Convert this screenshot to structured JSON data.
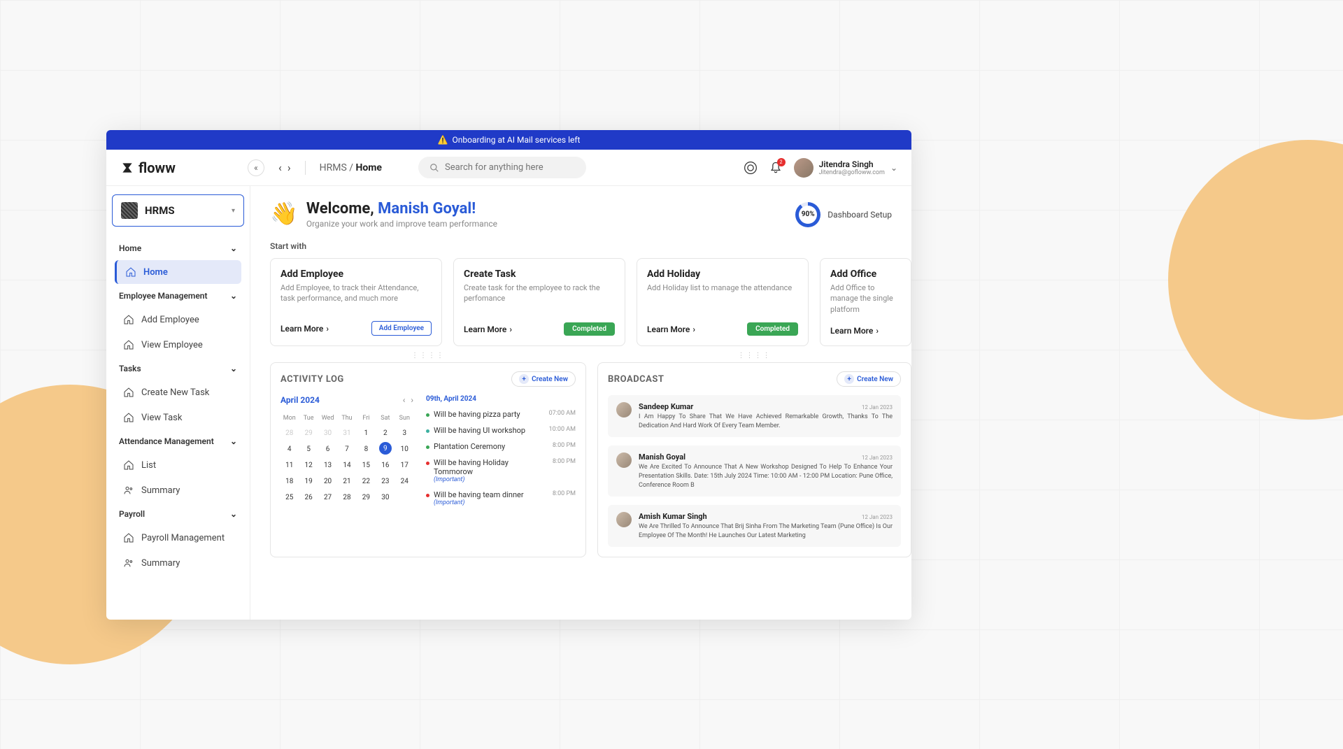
{
  "alert": {
    "text": "Onboarding at AI Mail services left"
  },
  "brand": "floww",
  "breadcrumb": {
    "parent": "HRMS",
    "current": "Home"
  },
  "search": {
    "placeholder": "Search for anything here"
  },
  "user": {
    "name": "Jitendra Singh",
    "email": "Jitendra@gofloww.com"
  },
  "module": {
    "name": "HRMS"
  },
  "nav": {
    "groups": [
      {
        "label": "Home",
        "items": [
          {
            "label": "Home",
            "active": true
          }
        ]
      },
      {
        "label": "Employee Management",
        "items": [
          {
            "label": "Add Employee"
          },
          {
            "label": "View Employee"
          }
        ]
      },
      {
        "label": "Tasks",
        "items": [
          {
            "label": "Create New Task"
          },
          {
            "label": "View Task"
          }
        ]
      },
      {
        "label": "Attendance Management",
        "items": [
          {
            "label": "List"
          },
          {
            "label": "Summary"
          }
        ]
      },
      {
        "label": "Payroll",
        "items": [
          {
            "label": "Payroll Management"
          },
          {
            "label": "Summary"
          }
        ]
      }
    ]
  },
  "welcome": {
    "greeting": "Welcome, ",
    "name": "Manish Goyal!",
    "subtitle": "Organize your work and improve team performance"
  },
  "setup": {
    "percent": "90%",
    "label": "Dashboard Setup"
  },
  "start_with_label": "Start with",
  "start_cards": [
    {
      "title": "Add Employee",
      "desc": "Add Employee, to track their Attendance, task performance, and much more",
      "learn": "Learn More",
      "action_label": "Add Employee",
      "action_type": "outline"
    },
    {
      "title": "Create Task",
      "desc": "Create task for the employee to rack the perfomance",
      "learn": "Learn More",
      "action_label": "Completed",
      "action_type": "green"
    },
    {
      "title": "Add Holiday",
      "desc": "Add Holiday list to manage the attendance",
      "learn": "Learn More",
      "action_label": "Completed",
      "action_type": "green"
    },
    {
      "title": "Add Office",
      "desc": "Add Office to manage the single platform",
      "learn": "Learn More",
      "action_label": "",
      "action_type": "none"
    }
  ],
  "activity": {
    "title": "ACTIVITY LOG",
    "create_label": "Create New",
    "calendar": {
      "month": "April 2024",
      "dow": [
        "Mon",
        "Tue",
        "Wed",
        "Thu",
        "Fri",
        "Sat",
        "Sun"
      ],
      "leading": [
        "28",
        "29",
        "30",
        "31"
      ],
      "days_count": 30,
      "selected": 9
    },
    "list_date": "09th, April 2024",
    "items": [
      {
        "dot": "green",
        "text": "Will be having pizza party",
        "time": "07:00 AM",
        "important": false
      },
      {
        "dot": "teal",
        "text": "Will be having UI workshop",
        "time": "10:00 AM",
        "important": false
      },
      {
        "dot": "green",
        "text": "Plantation Ceremony",
        "time": "8:00 PM",
        "important": false
      },
      {
        "dot": "red",
        "text": "Will be having Holiday Tommorow",
        "time": "8:00 PM",
        "important": true
      },
      {
        "dot": "red",
        "text": "Will be having team dinner",
        "time": "8:00 PM",
        "important": true
      }
    ],
    "important_label": "(Important)"
  },
  "broadcast": {
    "title": "BROADCAST",
    "create_label": "Create New",
    "items": [
      {
        "name": "Sandeep Kumar",
        "date": "12 Jan 2023",
        "text": "I Am Happy To Share That We Have Achieved Remarkable Growth, Thanks To The Dedication And Hard Work Of Every Team Member."
      },
      {
        "name": "Manish Goyal",
        "date": "12 Jan 2023",
        "text": "We Are Excited To Announce That A New Workshop Designed To Help To Enhance Your Presentation Skills. Date: 15th July 2024 Time: 10:00 AM - 12:00 PM Location: Pune Office, Conference Room B"
      },
      {
        "name": "Amish Kumar Singh",
        "date": "12 Jan 2023",
        "text": "We Are Thrilled To Announce That Brij Sinha From The Marketing Team (Pune Office) Is Our Employee Of The Month! He Launches Our Latest Marketing"
      }
    ]
  }
}
